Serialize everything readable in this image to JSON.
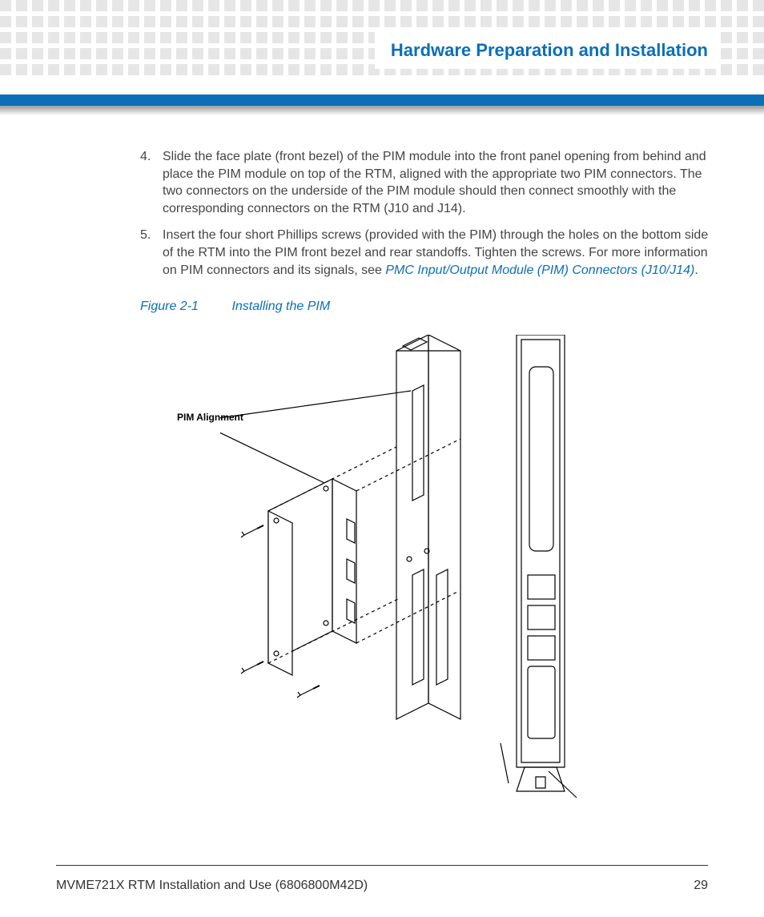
{
  "header": {
    "chapter_title": "Hardware Preparation and Installation"
  },
  "steps": {
    "item4": {
      "num": "4.",
      "text": "Slide the face plate (front bezel) of the PIM module into the front panel opening from behind and place the PIM module on top of the RTM, aligned with the appropriate two PIM connectors. The two connectors on the underside of the PIM module should then connect smoothly with the corresponding connectors on the RTM (J10 and J14)."
    },
    "item5": {
      "num": "5.",
      "text_before": "Insert the four short Phillips screws (provided with the PIM) through the holes on the bottom side of the RTM into the PIM front bezel and rear standoffs. Tighten the screws. For more information on PIM connectors and its signals, see ",
      "link": "PMC Input/Output Module (PIM) Connectors (J10/J14)",
      "text_after": "."
    }
  },
  "figure": {
    "number": "Figure 2-1",
    "title": "Installing the PIM",
    "label": "PIM  Alignment"
  },
  "footer": {
    "doc": "MVME721X RTM Installation and Use (6806800M42D)",
    "page": "29"
  }
}
